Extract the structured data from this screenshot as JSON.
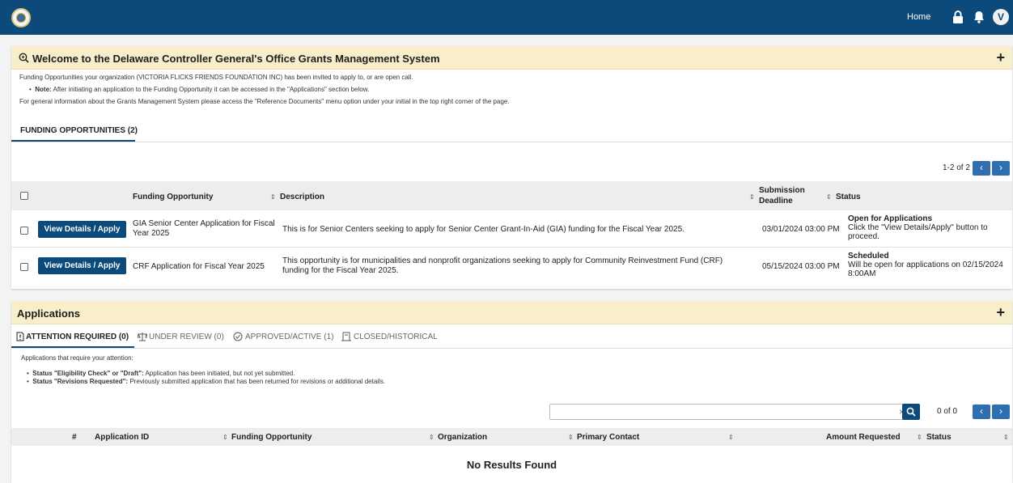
{
  "colors": {
    "topbar": "#0b4a7a",
    "panel_header": "#f8eecb",
    "button": "#0b4a7a",
    "pager": "#2f6fb0",
    "tab_underline": "#0b4a7a"
  },
  "topbar": {
    "home_label": "Home",
    "avatar_initial": "V",
    "icons": [
      "delaware-seal-icon",
      "lock-icon",
      "bell-icon"
    ]
  },
  "welcome": {
    "title": "Welcome to the Delaware Controller General's Office Grants Management System",
    "title_icon": "search-icon",
    "expand_label": "+",
    "intro": "Funding Opportunities your organization (VICTORIA FLICKS FRIENDS FOUNDATION INC) has been invited to apply to, or are open call.",
    "note_label": "Note:",
    "note_text": " After initiating an application to the Funding Opportunity it can be accessed in the \"Applications\" section below.",
    "general_info": "For general information about the Grants Management System please access the \"Reference Documents\" menu option under your initial in the top right corner of the page.",
    "tab_label": "FUNDING OPPORTUNITIES (2)",
    "pager_text": "1-2 of 2",
    "columns": {
      "funding_opportunity": "Funding Opportunity",
      "description": "Description",
      "deadline_line1": "Submission",
      "deadline_line2": "Deadline",
      "status": "Status"
    },
    "rows": [
      {
        "button": "View Details / Apply",
        "opportunity_line1": "GIA Senior Center Application for Fiscal",
        "opportunity_line2": "Year 2025",
        "description_line1": "This is for Senior Centers seeking to apply for Senior Center Grant-In-Aid (GIA) funding for the Fiscal Year 2025.",
        "description_line2": "",
        "deadline": "03/01/2024 03:00 PM",
        "status_title": "Open for Applications",
        "status_line1": "Click the \"View Details/Apply\" button to",
        "status_line2": "proceed."
      },
      {
        "button": "View Details / Apply",
        "opportunity_line1": "CRF Application for Fiscal Year 2025",
        "opportunity_line2": "",
        "description_line1": "This opportunity is for municipalities and nonprofit organizations seeking to apply for Community Reinvestment Fund (CRF)",
        "description_line2": "funding for the Fiscal Year 2025.",
        "deadline": "05/15/2024 03:00 PM",
        "status_title": "Scheduled",
        "status_line1": "Will be open for applications on 02/15/2024",
        "status_line2": "8:00AM"
      }
    ]
  },
  "applications": {
    "title": "Applications",
    "expand_label": "+",
    "tabs": [
      {
        "label": "ATTENTION REQUIRED (0)",
        "icon": "document-alert-icon"
      },
      {
        "label": "UNDER REVIEW (0)",
        "icon": "scale-icon"
      },
      {
        "label": "APPROVED/ACTIVE (1)",
        "icon": "check-circle-icon"
      },
      {
        "label": "CLOSED/HISTORICAL",
        "icon": "archive-icon"
      }
    ],
    "intro": "Applications that require your attention:",
    "bullet1_label": "Status \"Eligibility Check\" or \"Draft\":",
    "bullet1_text": " Application has been initiated, but not yet submitted.",
    "bullet2_label": "Status \"Revisions Requested\":",
    "bullet2_text": " Previously submitted application that has been returned for revisions or additional details.",
    "search_value": "",
    "clear_label": "×",
    "pager_text": "0 of 0",
    "columns": {
      "number": "#",
      "application_id": "Application ID",
      "funding_opportunity": "Funding Opportunity",
      "organization": "Organization",
      "primary_contact": "Primary Contact",
      "amount_requested": "Amount Requested",
      "status": "Status"
    },
    "empty_text": "No Results Found"
  }
}
